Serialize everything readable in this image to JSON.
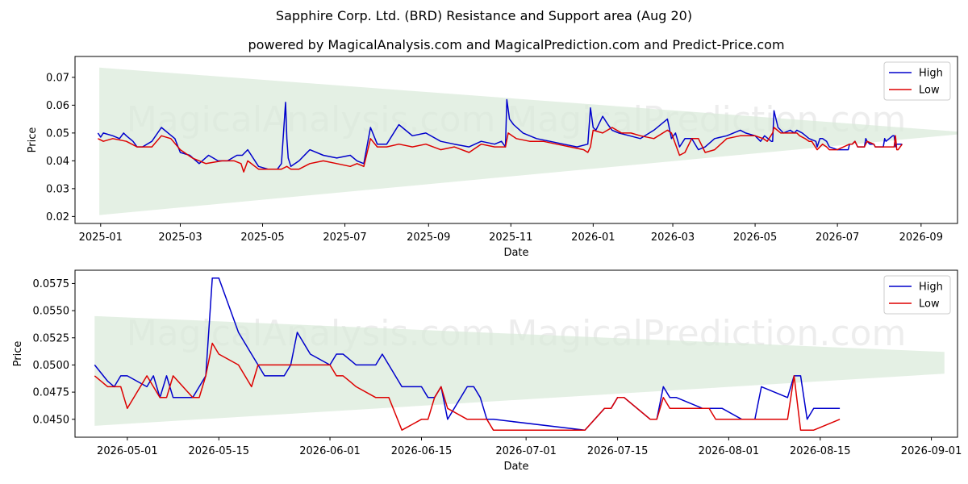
{
  "title": "Sapphire Corp. Ltd. (BRD) Resistance and Support area (Aug 20)",
  "subtitle": "powered by MagicalAnalysis.com and MagicalPrediction.com and Predict-Price.com",
  "watermark": "MagicalAnalysis.com   MagicalPrediction.com",
  "colors": {
    "high": "#0000cc",
    "low": "#dd0000",
    "band": "#d8ead8"
  },
  "chart_data": [
    {
      "type": "line",
      "xlabel": "Date",
      "ylabel": "Price",
      "xlim": [
        "2024-12-13",
        "2026-09-28"
      ],
      "ylim": [
        0.0175,
        0.0775
      ],
      "x_ticks": [
        "2025-01",
        "2025-03",
        "2025-05",
        "2025-07",
        "2025-09",
        "2025-11",
        "2026-01",
        "2026-03",
        "2026-05",
        "2026-07",
        "2026-09"
      ],
      "x_tick_dates": [
        "2025-01-01",
        "2025-03-01",
        "2025-05-01",
        "2025-07-01",
        "2025-09-01",
        "2025-11-01",
        "2026-01-01",
        "2026-03-01",
        "2026-05-01",
        "2026-07-01",
        "2026-09-01"
      ],
      "y_ticks": [
        0.02,
        0.03,
        0.04,
        0.05,
        0.06,
        0.07
      ],
      "y_tick_labels": [
        "0.02",
        "0.03",
        "0.04",
        "0.05",
        "0.06",
        "0.07"
      ],
      "legend": "top-right",
      "grid": false,
      "band": {
        "x": [
          "2024-12-31",
          "2026-09-28"
        ],
        "upper": [
          0.0735,
          0.0505
        ],
        "lower": [
          0.0205,
          0.0495
        ]
      },
      "series": [
        {
          "name": "High",
          "x": [
            "2024-12-30",
            "2025-01-01",
            "2025-01-03",
            "2025-01-10",
            "2025-01-15",
            "2025-01-18",
            "2025-01-20",
            "2025-01-25",
            "2025-01-28",
            "2025-02-01",
            "2025-02-08",
            "2025-02-15",
            "2025-02-20",
            "2025-02-25",
            "2025-03-01",
            "2025-03-08",
            "2025-03-15",
            "2025-03-22",
            "2025-03-29",
            "2025-04-05",
            "2025-04-12",
            "2025-04-16",
            "2025-04-20",
            "2025-04-28",
            "2025-05-05",
            "2025-05-12",
            "2025-05-15",
            "2025-05-18",
            "2025-05-19",
            "2025-05-20",
            "2025-05-22",
            "2025-05-28",
            "2025-06-05",
            "2025-06-15",
            "2025-06-25",
            "2025-07-05",
            "2025-07-10",
            "2025-07-15",
            "2025-07-20",
            "2025-07-25",
            "2025-08-01",
            "2025-08-10",
            "2025-08-20",
            "2025-08-30",
            "2025-09-10",
            "2025-09-20",
            "2025-10-01",
            "2025-10-10",
            "2025-10-20",
            "2025-10-25",
            "2025-10-28",
            "2025-10-29",
            "2025-10-31",
            "2025-11-03",
            "2025-11-10",
            "2025-11-20",
            "2025-11-30",
            "2025-12-10",
            "2025-12-20",
            "2025-12-28",
            "2025-12-30",
            "2026-01-01",
            "2026-01-03",
            "2026-01-08",
            "2026-01-12",
            "2026-01-15",
            "2026-01-20",
            "2026-01-28",
            "2026-02-05",
            "2026-02-15",
            "2026-02-25",
            "2026-02-28",
            "2026-03-03",
            "2026-03-06",
            "2026-03-10",
            "2026-03-15",
            "2026-03-20",
            "2026-03-25",
            "2026-04-01",
            "2026-04-10",
            "2026-04-20",
            "2026-04-24",
            "2026-05-01",
            "2026-05-05",
            "2026-05-08",
            "2026-05-13",
            "2026-05-14",
            "2026-05-15",
            "2026-05-18",
            "2026-05-22",
            "2026-05-27",
            "2026-05-30",
            "2026-06-01",
            "2026-06-05",
            "2026-06-10",
            "2026-06-15",
            "2026-06-16",
            "2026-06-18",
            "2026-06-20",
            "2026-06-23",
            "2026-06-25",
            "2026-07-01",
            "2026-07-09",
            "2026-07-10",
            "2026-07-12",
            "2026-07-14",
            "2026-07-16",
            "2026-07-21",
            "2026-07-22",
            "2026-07-23",
            "2026-07-25",
            "2026-07-28",
            "2026-07-29",
            "2026-08-04",
            "2026-08-05",
            "2026-08-06",
            "2026-08-11",
            "2026-08-12",
            "2026-08-13",
            "2026-08-14",
            "2026-08-18"
          ],
          "y": [
            0.05,
            0.0485,
            0.05,
            0.049,
            0.048,
            0.05,
            0.049,
            0.047,
            0.045,
            0.045,
            0.047,
            0.052,
            0.05,
            0.048,
            0.043,
            0.042,
            0.039,
            0.042,
            0.04,
            0.04,
            0.042,
            0.042,
            0.044,
            0.038,
            0.037,
            0.037,
            0.039,
            0.061,
            0.048,
            0.041,
            0.038,
            0.04,
            0.044,
            0.042,
            0.041,
            0.042,
            0.04,
            0.039,
            0.052,
            0.046,
            0.046,
            0.053,
            0.049,
            0.05,
            0.047,
            0.046,
            0.045,
            0.047,
            0.046,
            0.047,
            0.045,
            0.062,
            0.055,
            0.053,
            0.05,
            0.048,
            0.047,
            0.046,
            0.045,
            0.046,
            0.059,
            0.052,
            0.051,
            0.056,
            0.053,
            0.051,
            0.05,
            0.049,
            0.048,
            0.051,
            0.055,
            0.048,
            0.05,
            0.045,
            0.048,
            0.048,
            0.044,
            0.045,
            0.048,
            0.049,
            0.051,
            0.05,
            0.049,
            0.047,
            0.049,
            0.047,
            0.047,
            0.058,
            0.052,
            0.05,
            0.051,
            0.05,
            0.051,
            0.05,
            0.048,
            0.047,
            0.045,
            0.048,
            0.048,
            0.047,
            0.045,
            0.044,
            0.044,
            0.046,
            0.046,
            0.047,
            0.045,
            0.045,
            0.048,
            0.047,
            0.046,
            0.046,
            0.045,
            0.045,
            0.048,
            0.047,
            0.049,
            0.049,
            0.045,
            0.046,
            0.046
          ]
        },
        {
          "name": "Low",
          "x": [
            "2024-12-30",
            "2025-01-03",
            "2025-01-10",
            "2025-01-20",
            "2025-01-28",
            "2025-02-08",
            "2025-02-15",
            "2025-02-22",
            "2025-03-01",
            "2025-03-10",
            "2025-03-20",
            "2025-04-01",
            "2025-04-10",
            "2025-04-15",
            "2025-04-17",
            "2025-04-20",
            "2025-04-28",
            "2025-05-05",
            "2025-05-15",
            "2025-05-19",
            "2025-05-22",
            "2025-05-28",
            "2025-06-05",
            "2025-06-15",
            "2025-06-25",
            "2025-07-05",
            "2025-07-10",
            "2025-07-15",
            "2025-07-20",
            "2025-07-25",
            "2025-08-01",
            "2025-08-10",
            "2025-08-20",
            "2025-08-30",
            "2025-09-10",
            "2025-09-20",
            "2025-10-01",
            "2025-10-10",
            "2025-10-20",
            "2025-10-28",
            "2025-10-30",
            "2025-11-05",
            "2025-11-15",
            "2025-11-25",
            "2025-12-05",
            "2025-12-15",
            "2025-12-25",
            "2025-12-28",
            "2025-12-30",
            "2026-01-01",
            "2026-01-08",
            "2026-01-15",
            "2026-01-22",
            "2026-01-29",
            "2026-02-05",
            "2026-02-15",
            "2026-02-25",
            "2026-02-28",
            "2026-03-03",
            "2026-03-06",
            "2026-03-10",
            "2026-03-15",
            "2026-03-20",
            "2026-03-25",
            "2026-04-01",
            "2026-04-10",
            "2026-04-20",
            "2026-04-25",
            "2026-05-01",
            "2026-05-07",
            "2026-05-10",
            "2026-05-14",
            "2026-05-15",
            "2026-05-20",
            "2026-05-22",
            "2026-05-27",
            "2026-06-01",
            "2026-06-03",
            "2026-06-07",
            "2026-06-10",
            "2026-06-12",
            "2026-06-16",
            "2026-06-18",
            "2026-06-20",
            "2026-06-23",
            "2026-06-25",
            "2026-07-01",
            "2026-07-10",
            "2026-07-12",
            "2026-07-14",
            "2026-07-16",
            "2026-07-21",
            "2026-07-23",
            "2026-07-28",
            "2026-07-29",
            "2026-08-04",
            "2026-08-08",
            "2026-08-12",
            "2026-08-13",
            "2026-08-14",
            "2026-08-15",
            "2026-08-18"
          ],
          "y": [
            0.048,
            0.047,
            0.048,
            0.047,
            0.045,
            0.045,
            0.049,
            0.048,
            0.044,
            0.041,
            0.039,
            0.04,
            0.04,
            0.039,
            0.036,
            0.04,
            0.037,
            0.037,
            0.037,
            0.038,
            0.037,
            0.037,
            0.039,
            0.04,
            0.039,
            0.038,
            0.039,
            0.038,
            0.048,
            0.045,
            0.045,
            0.046,
            0.045,
            0.046,
            0.044,
            0.045,
            0.043,
            0.046,
            0.045,
            0.045,
            0.05,
            0.048,
            0.047,
            0.047,
            0.046,
            0.045,
            0.044,
            0.043,
            0.045,
            0.051,
            0.05,
            0.052,
            0.05,
            0.05,
            0.049,
            0.048,
            0.051,
            0.05,
            0.046,
            0.042,
            0.043,
            0.048,
            0.048,
            0.043,
            0.044,
            0.048,
            0.049,
            0.049,
            0.049,
            0.048,
            0.047,
            0.05,
            0.052,
            0.05,
            0.05,
            0.05,
            0.05,
            0.049,
            0.048,
            0.047,
            0.047,
            0.044,
            0.045,
            0.046,
            0.045,
            0.044,
            0.044,
            0.046,
            0.046,
            0.047,
            0.045,
            0.045,
            0.047,
            0.046,
            0.045,
            0.045,
            0.045,
            0.045,
            0.049,
            0.044,
            0.044,
            0.046
          ]
        }
      ]
    },
    {
      "type": "line",
      "xlabel": "Date",
      "ylabel": "Price",
      "xlim": [
        "2026-04-23",
        "2026-09-05"
      ],
      "ylim": [
        0.04335,
        0.05872
      ],
      "x_ticks": [
        "2026-05-01",
        "2026-05-15",
        "2026-06-01",
        "2026-06-15",
        "2026-07-01",
        "2026-07-15",
        "2026-08-01",
        "2026-08-15",
        "2026-09-01"
      ],
      "y_ticks": [
        0.045,
        0.0475,
        0.05,
        0.0525,
        0.055,
        0.0575
      ],
      "y_tick_labels": [
        "0.0450",
        "0.0475",
        "0.0500",
        "0.0525",
        "0.0550",
        "0.0575"
      ],
      "legend": "top-right",
      "grid": false,
      "band": {
        "x": [
          "2026-04-26",
          "2026-09-03"
        ],
        "upper": [
          0.0545,
          0.0512
        ],
        "lower": [
          0.0444,
          0.0492
        ]
      },
      "series": [
        {
          "name": "High",
          "x": [
            "2026-04-26",
            "2026-04-28",
            "2026-04-29",
            "2026-04-30",
            "2026-05-01",
            "2026-05-04",
            "2026-05-05",
            "2026-05-06",
            "2026-05-07",
            "2026-05-08",
            "2026-05-11",
            "2026-05-12",
            "2026-05-13",
            "2026-05-14",
            "2026-05-15",
            "2026-05-18",
            "2026-05-19",
            "2026-05-20",
            "2026-05-21",
            "2026-05-22",
            "2026-05-25",
            "2026-05-26",
            "2026-05-27",
            "2026-05-28",
            "2026-05-29",
            "2026-06-01",
            "2026-06-02",
            "2026-06-03",
            "2026-06-04",
            "2026-06-05",
            "2026-06-08",
            "2026-06-09",
            "2026-06-10",
            "2026-06-11",
            "2026-06-12",
            "2026-06-15",
            "2026-06-16",
            "2026-06-17",
            "2026-06-18",
            "2026-06-19",
            "2026-06-22",
            "2026-06-23",
            "2026-06-24",
            "2026-06-25",
            "2026-06-26",
            "2026-07-10",
            "2026-07-13",
            "2026-07-14",
            "2026-07-15",
            "2026-07-16",
            "2026-07-20",
            "2026-07-21",
            "2026-07-22",
            "2026-07-23",
            "2026-07-24",
            "2026-07-28",
            "2026-07-29",
            "2026-07-30",
            "2026-07-31",
            "2026-08-03",
            "2026-08-04",
            "2026-08-05",
            "2026-08-06",
            "2026-08-10",
            "2026-08-11",
            "2026-08-12",
            "2026-08-13",
            "2026-08-14",
            "2026-08-18"
          ],
          "y": [
            0.05,
            0.0485,
            0.048,
            0.049,
            0.049,
            0.048,
            0.049,
            0.047,
            0.049,
            0.047,
            0.047,
            0.048,
            0.049,
            0.058,
            0.058,
            0.053,
            0.052,
            0.051,
            0.05,
            0.049,
            0.049,
            0.05,
            0.053,
            0.052,
            0.051,
            0.05,
            0.051,
            0.051,
            0.0505,
            0.05,
            0.05,
            0.051,
            0.05,
            0.049,
            0.048,
            0.048,
            0.047,
            0.047,
            0.048,
            0.045,
            0.048,
            0.048,
            0.047,
            0.045,
            0.045,
            0.044,
            0.046,
            0.046,
            0.047,
            0.047,
            0.045,
            0.045,
            0.048,
            0.047,
            0.047,
            0.046,
            0.046,
            0.046,
            0.046,
            0.045,
            0.045,
            0.045,
            0.048,
            0.047,
            0.049,
            0.049,
            0.045,
            0.046,
            0.046
          ]
        },
        {
          "name": "Low",
          "x": [
            "2026-04-26",
            "2026-04-28",
            "2026-04-29",
            "2026-04-30",
            "2026-05-01",
            "2026-05-04",
            "2026-05-05",
            "2026-05-06",
            "2026-05-07",
            "2026-05-08",
            "2026-05-11",
            "2026-05-12",
            "2026-05-13",
            "2026-05-14",
            "2026-05-15",
            "2026-05-18",
            "2026-05-19",
            "2026-05-20",
            "2026-05-21",
            "2026-05-22",
            "2026-05-25",
            "2026-05-26",
            "2026-05-27",
            "2026-05-28",
            "2026-05-29",
            "2026-06-01",
            "2026-06-02",
            "2026-06-03",
            "2026-06-04",
            "2026-06-05",
            "2026-06-08",
            "2026-06-09",
            "2026-06-10",
            "2026-06-11",
            "2026-06-12",
            "2026-06-15",
            "2026-06-16",
            "2026-06-17",
            "2026-06-18",
            "2026-06-19",
            "2026-06-22",
            "2026-06-23",
            "2026-06-24",
            "2026-06-25",
            "2026-06-26",
            "2026-07-10",
            "2026-07-13",
            "2026-07-14",
            "2026-07-15",
            "2026-07-16",
            "2026-07-20",
            "2026-07-21",
            "2026-07-22",
            "2026-07-23",
            "2026-07-24",
            "2026-07-28",
            "2026-07-29",
            "2026-07-30",
            "2026-07-31",
            "2026-08-03",
            "2026-08-04",
            "2026-08-05",
            "2026-08-06",
            "2026-08-10",
            "2026-08-11",
            "2026-08-12",
            "2026-08-13",
            "2026-08-14",
            "2026-08-18"
          ],
          "y": [
            0.049,
            0.048,
            0.048,
            0.048,
            0.046,
            0.049,
            0.048,
            0.047,
            0.047,
            0.049,
            0.047,
            0.047,
            0.049,
            0.052,
            0.051,
            0.05,
            0.049,
            0.048,
            0.05,
            0.05,
            0.05,
            0.05,
            0.05,
            0.05,
            0.05,
            0.05,
            0.049,
            0.049,
            0.0485,
            0.048,
            0.047,
            0.047,
            0.047,
            0.0455,
            0.044,
            0.045,
            0.045,
            0.047,
            0.048,
            0.046,
            0.045,
            0.045,
            0.045,
            0.045,
            0.044,
            0.044,
            0.046,
            0.046,
            0.047,
            0.047,
            0.045,
            0.045,
            0.047,
            0.046,
            0.046,
            0.046,
            0.046,
            0.045,
            0.045,
            0.045,
            0.045,
            0.045,
            0.045,
            0.045,
            0.049,
            0.044,
            0.044,
            0.044,
            0.045
          ]
        }
      ]
    }
  ]
}
